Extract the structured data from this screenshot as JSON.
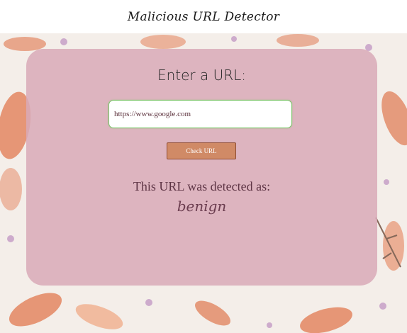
{
  "header": {
    "title": "Malicious URL Detector"
  },
  "form": {
    "heading": "Enter a URL:",
    "url_value": "https://www.google.com",
    "button_label": "Check URL"
  },
  "result": {
    "label": "This URL was detected as:",
    "value": "benign"
  },
  "colors": {
    "card": "#d9aab8",
    "button": "#d08a66",
    "input_border": "#7cc46a",
    "koi_orange": "#e07a52",
    "blossom": "#c9a3c9"
  }
}
